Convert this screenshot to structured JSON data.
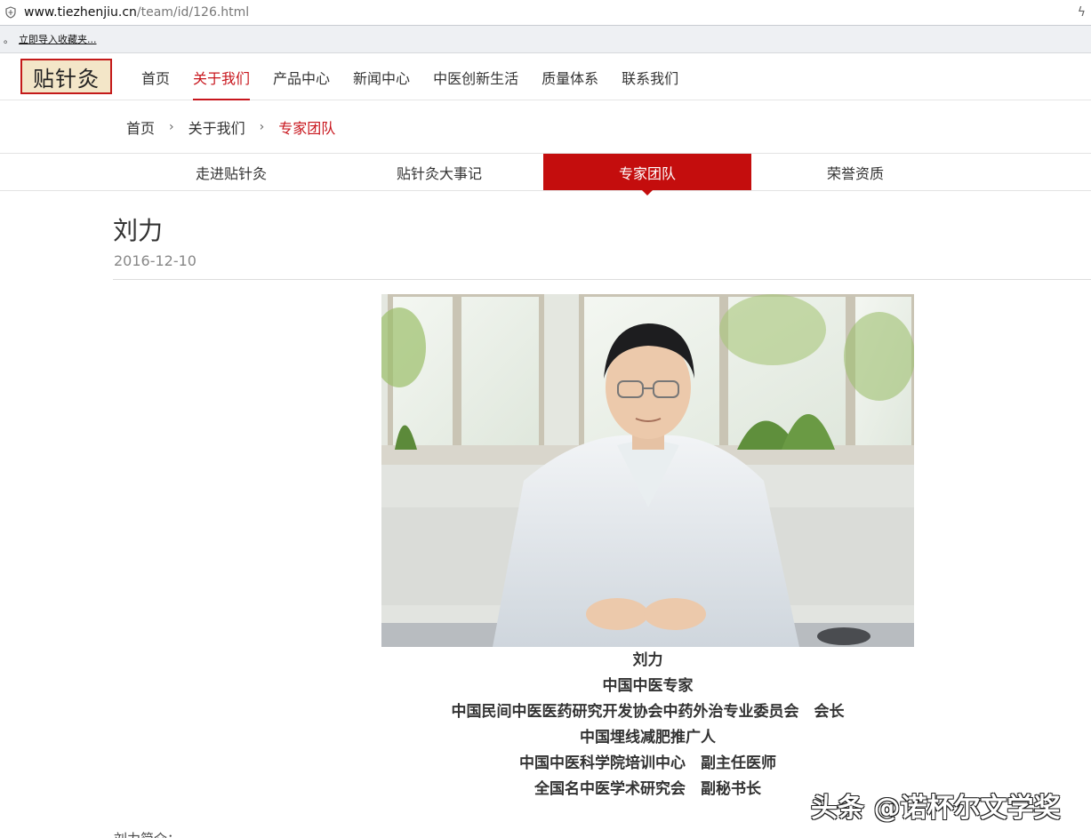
{
  "browser": {
    "url_host": "www.tiezhenjiu.cn",
    "url_path": "/team/id/126.html",
    "bookmark_dot": "。",
    "bookmark_link": "立即导入收藏夹..."
  },
  "site": {
    "logo_text": "贴针灸",
    "nav": [
      {
        "label": "首页"
      },
      {
        "label": "关于我们"
      },
      {
        "label": "产品中心"
      },
      {
        "label": "新闻中心"
      },
      {
        "label": "中医创新生活"
      },
      {
        "label": "质量体系"
      },
      {
        "label": "联系我们"
      }
    ],
    "active_nav": "关于我们",
    "brand_color": "#c8161d"
  },
  "breadcrumb": {
    "items": [
      "首页",
      "关于我们",
      "专家团队"
    ],
    "separator": "›"
  },
  "subtabs": [
    {
      "label": "走进贴针灸"
    },
    {
      "label": "贴针灸大事记"
    },
    {
      "label": "专家团队"
    },
    {
      "label": "荣誉资质"
    }
  ],
  "active_subtab": "专家团队",
  "article": {
    "title": "刘力",
    "date": "2016-12-10",
    "captions": [
      "刘力",
      "中国中医专家",
      "中国民间中医医药研究开发协会中药外治专业委员会　会长",
      "中国埋线减肥推广人",
      "中国中医科学院培训中心　副主任医师",
      "全国名中医学术研究会　副秘书长"
    ],
    "intro_label": "刘力简介："
  },
  "watermark": "头条 @诺杯尔文学奖"
}
